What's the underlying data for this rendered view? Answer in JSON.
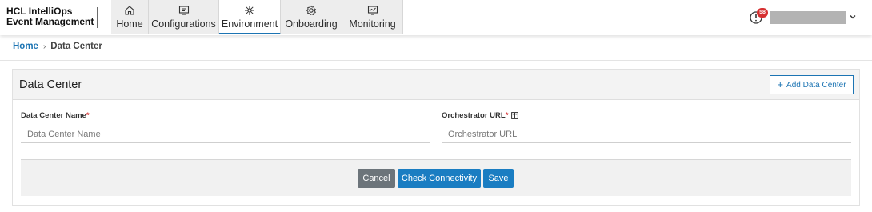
{
  "brand": {
    "line1": "HCL IntelliOps",
    "line2": "Event Management"
  },
  "nav": {
    "items": [
      {
        "label": "Home",
        "icon": "home-icon"
      },
      {
        "label": "Configurations",
        "icon": "configurations-icon"
      },
      {
        "label": "Environment",
        "icon": "environment-icon",
        "active": true
      },
      {
        "label": "Onboarding",
        "icon": "onboarding-icon"
      },
      {
        "label": "Monitoring",
        "icon": "monitoring-icon"
      }
    ]
  },
  "header": {
    "alert_count": "58",
    "alert_icon": "alert-icon",
    "user_menu_icon": "chevron-down-icon"
  },
  "breadcrumb": {
    "home": "Home",
    "separator": "›",
    "current": "Data Center"
  },
  "card": {
    "title": "Data Center",
    "add_button": {
      "icon": "+",
      "label": "Add Data Center"
    },
    "fields": {
      "name": {
        "label": "Data Center Name",
        "required": "*",
        "placeholder": "Data Center Name",
        "value": ""
      },
      "url": {
        "label": "Orchestrator URL",
        "required": "*",
        "placeholder": "Orchestrator URL",
        "value": "",
        "icon": "info-icon"
      }
    },
    "buttons": {
      "cancel": "Cancel",
      "check": "Check Connectivity",
      "save": "Save"
    }
  },
  "colors": {
    "accent": "#1c74b3",
    "primary_button": "#1a7dc2",
    "cancel_button": "#6c747a",
    "badge": "#d63031"
  }
}
